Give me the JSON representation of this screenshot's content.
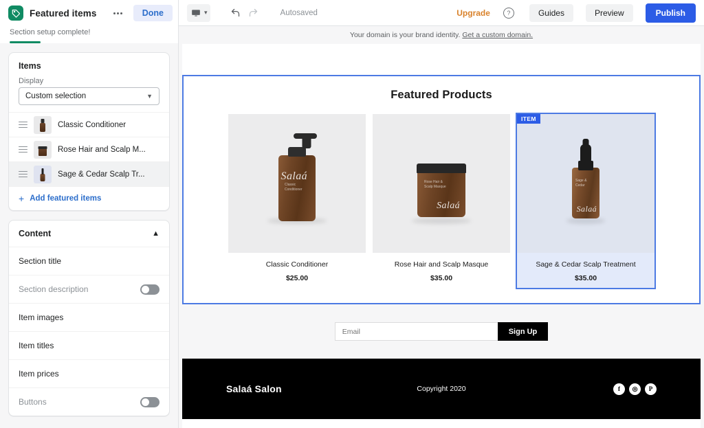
{
  "sidebar": {
    "title": "Featured items",
    "icon": "tag-icon",
    "more_label": "•••",
    "done_label": "Done",
    "setup_text": "Section setup complete!",
    "setup_progress_pct": 100,
    "items_card": {
      "title": "Items",
      "display_label": "Display",
      "display_value": "Custom selection",
      "display_options": [
        "Custom selection"
      ],
      "items": [
        {
          "name": "Classic Conditioner",
          "thumb": "bottle-thumb",
          "selected": false
        },
        {
          "name": "Rose Hair and Scalp M...",
          "thumb": "jar-thumb",
          "selected": false
        },
        {
          "name": "Sage & Cedar Scalp Tr...",
          "thumb": "dropper-thumb",
          "selected": true
        }
      ],
      "add_label": "Add featured items",
      "add_icon": "plus-icon"
    },
    "content_card": {
      "title": "Content",
      "collapse_icon": "chevron-up-icon",
      "rows": [
        {
          "label": "Section title",
          "toggle": null,
          "muted": false
        },
        {
          "label": "Section description",
          "toggle": "off",
          "muted": true
        },
        {
          "label": "Item images",
          "toggle": null,
          "muted": false
        },
        {
          "label": "Item titles",
          "toggle": null,
          "muted": false
        },
        {
          "label": "Item prices",
          "toggle": null,
          "muted": false
        },
        {
          "label": "Buttons",
          "toggle": "off",
          "muted": true
        }
      ]
    }
  },
  "topbar": {
    "device_icon": "desktop-icon",
    "device_caret": "▾",
    "undo_icon": "undo-arrow-icon",
    "redo_icon": "redo-arrow-icon",
    "autosaved_label": "Autosaved",
    "upgrade_label": "Upgrade",
    "help_icon": "question-mark-icon",
    "help_glyph": "?",
    "guides_label": "Guides",
    "preview_label": "Preview",
    "publish_label": "Publish",
    "accent_publish": "#2c5ce6",
    "accent_upgrade": "#d9822b"
  },
  "preview": {
    "domain_banner": {
      "text": "Your domain is your brand identity.",
      "link": "Get a custom domain."
    },
    "section": {
      "title": "Featured Products",
      "selected_badge": "ITEM",
      "selection_color": "#4c7ae3",
      "products": [
        {
          "name": "Classic Conditioner",
          "price": "$25.00",
          "art": "pump-bottle",
          "selected": false
        },
        {
          "name": "Rose Hair and Scalp Masque",
          "price": "$35.00",
          "art": "jar",
          "selected": false
        },
        {
          "name": "Sage & Cedar Scalp Treatment",
          "price": "$35.00",
          "art": "dropper-bottle",
          "selected": true
        }
      ]
    },
    "signup": {
      "email_placeholder": "Email",
      "email_value": "",
      "button_label": "Sign Up"
    },
    "footer": {
      "brand": "Salaá Salon",
      "copyright": "Copyright 2020",
      "social": [
        {
          "name": "facebook-icon",
          "glyph": "f"
        },
        {
          "name": "instagram-icon",
          "glyph": "◎"
        },
        {
          "name": "pinterest-icon",
          "glyph": "P"
        }
      ]
    }
  }
}
